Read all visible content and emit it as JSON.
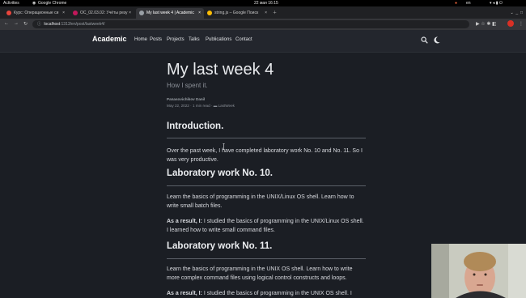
{
  "system_bar": {
    "activities": "Activities",
    "app": "Google Chrome",
    "clock": "22 мая 16:15",
    "lang": "en"
  },
  "tabs": [
    {
      "label": "Курс: Операционные си",
      "color": "#e8453c"
    },
    {
      "label": "ОС_02.03.02: Учёты резу",
      "color": "#c2185b"
    },
    {
      "label": "My last week 4 | Academic",
      "color": "#9aa0a6"
    },
    {
      "label": "string.js – Google Поиск",
      "color": "#fbbc05"
    }
  ],
  "address": {
    "host": "localhost",
    "path": ":1313/en/post/lastweek4/"
  },
  "site": {
    "brand": "Academic",
    "nav": [
      "Home",
      "Posts",
      "Projects",
      "Talks",
      "Publications",
      "Contact"
    ]
  },
  "article": {
    "title": "My last week 4",
    "subtitle": "How I spent it.",
    "author": "Panasovichikov Danil",
    "date": "May 22, 2022",
    "read_time": "1 min read",
    "category": "LastWeek",
    "sections": [
      {
        "heading": "Introduction.",
        "paragraphs": [
          {
            "bold": "",
            "text": "Over the past week, I have completed laboratory work No. 10 and No. 11. So I was very productive."
          }
        ]
      },
      {
        "heading": "Laboratory work No. 10.",
        "paragraphs": [
          {
            "bold": "",
            "text": "Learn the basics of programming in the UNIX/Linux OS shell. Learn how to write small batch files."
          },
          {
            "bold": "As a result, I:",
            "text": " I studied the basics of programming in the UNIX/Linux OS shell. I learned how to write small command files."
          }
        ]
      },
      {
        "heading": "Laboratory work No. 11.",
        "paragraphs": [
          {
            "bold": "",
            "text": "Learn the basics of programming in the UNIX OS shell. Learn how to write more complex command files using logical control constructs and loops."
          },
          {
            "bold": "As a result, I:",
            "text": " I studied the basics of programming in the UNIX OS shell. I"
          }
        ]
      }
    ]
  }
}
